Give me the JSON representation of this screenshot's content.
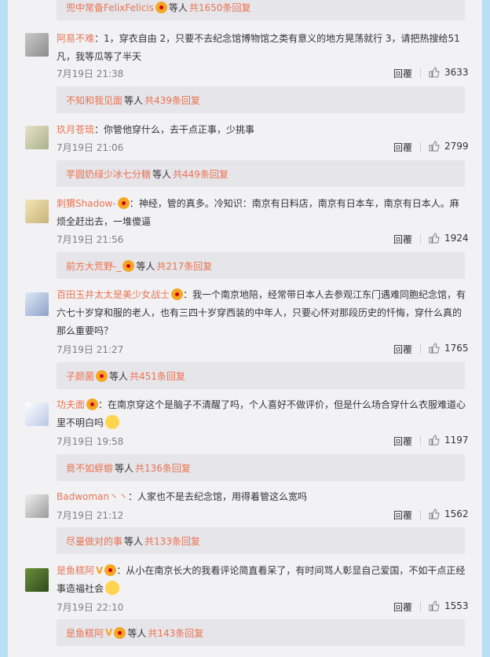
{
  "comments": [
    {
      "reply_preview": {
        "who": "兜中常备FelixFelicis",
        "mid": "等人",
        "count": "共1650条回复"
      }
    },
    {
      "name": "阿易不难",
      "text": "：1，穿衣自由 2，只要不去纪念馆博物馆之类有意义的地方晃荡就行 3，请把热搜给51凡，我等瓜等了半天",
      "time": "7月19日 21:38",
      "reply": "回覆",
      "likes": "3633",
      "reply_preview": {
        "who": "不知和我见面",
        "mid": "等人",
        "count": "共439条回复"
      }
    },
    {
      "name": "玖月苍琉",
      "text": "：你管他穿什么，去干点正事，少挑事",
      "time": "7月19日 21:06",
      "reply": "回覆",
      "likes": "2799",
      "reply_preview": {
        "who": "芋圆奶绿少冰七分糖",
        "mid": "等人",
        "count": "共449条回复"
      }
    },
    {
      "name": "刺猬Shadow-",
      "text": "：神经，管的真多。冷知识：南京有日料店，南京有日本车，南京有日本人。麻烦全赶出去，一堆傻逼",
      "time": "7月19日 21:56",
      "reply": "回覆",
      "likes": "1924",
      "reply_preview": {
        "who": "前方大荒野-_",
        "mid": "等人",
        "count": "共217条回复"
      }
    },
    {
      "name": "百田玉井太太是美少女战士",
      "text": "：我一个南京地陪，经常带日本人去参观江东门遇难同胞纪念馆，有六七十岁穿和服的老人，也有三四十岁穿西装的中年人，只要心怀对那段历史的忏悔，穿什么真的那么重要吗？",
      "time": "7月19日 21:27",
      "reply": "回覆",
      "likes": "1765",
      "reply_preview": {
        "who": "子颜菌",
        "mid": "等人",
        "count": "共451条回复"
      }
    },
    {
      "name": "功夫面",
      "text": "：在南京穿这个是脑子不清醒了吗，个人喜好不做评价，但是什么场合穿什么衣服难道心里不明白吗",
      "time": "7月19日 19:58",
      "reply": "回覆",
      "likes": "1197",
      "reply_preview": {
        "who": "竟不如蜉蝣",
        "mid": "等人",
        "count": "共136条回复"
      }
    },
    {
      "name": "Badwoman丶丶",
      "text": "：人家也不是去纪念馆，用得着管这么宽吗",
      "time": "7月19日 21:12",
      "reply": "回覆",
      "likes": "1562",
      "reply_preview": {
        "who": "尽量做对的事",
        "mid": "等人",
        "count": "共133条回复"
      }
    },
    {
      "name": "是鱼糕阿",
      "text": "：从小在南京长大的我看评论简直看呆了，有时间骂人彰显自己爱国，不如干点正经事造福社会",
      "time": "7月19日 22:10",
      "reply": "回覆",
      "likes": "1553",
      "reply_preview": {
        "who": "是鱼糕阿",
        "mid": "等人",
        "count": "共143条回复"
      }
    }
  ],
  "colors": {
    "accent": "#eb7350",
    "background": "#b9dff5",
    "panel": "#f2f2f5"
  },
  "icons": {
    "like": "thumbs-up-icon",
    "badge": "vip-badge-icon"
  }
}
